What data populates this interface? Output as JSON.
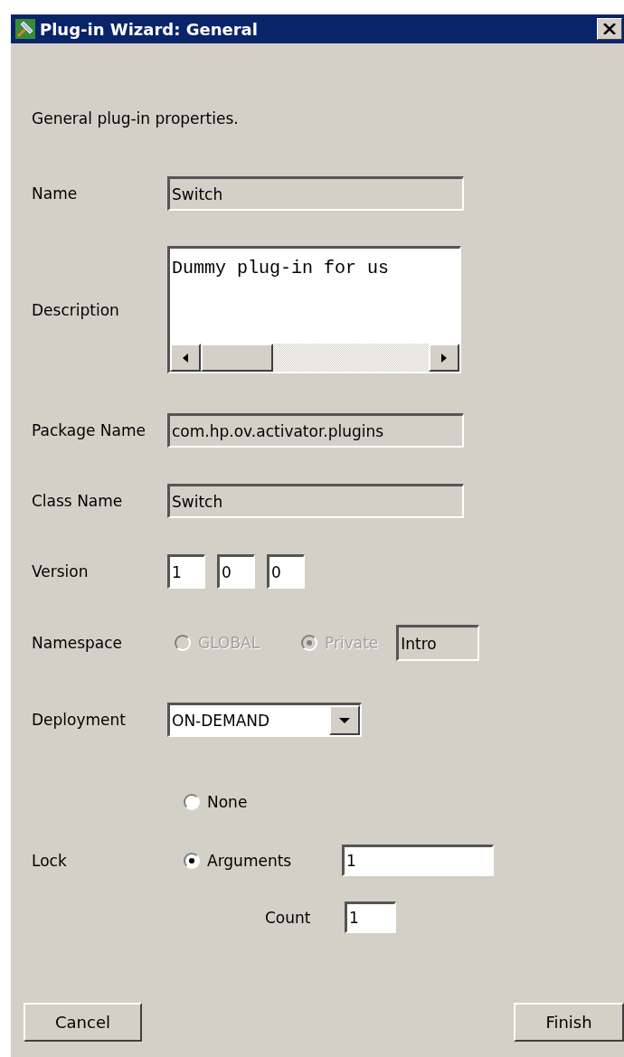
{
  "window": {
    "title": "Plug-in Wizard: General"
  },
  "intro": "General plug-in properties.",
  "name": {
    "label": "Name",
    "value": "Switch",
    "read_only": true
  },
  "description": {
    "label": "Description",
    "value": "Dummy plug-in for us",
    "read_only": false
  },
  "package_name": {
    "label": "Package Name",
    "value": "com.hp.ov.activator.plugins",
    "read_only": true
  },
  "class_name": {
    "label": "Class Name",
    "value": "Switch",
    "read_only": true
  },
  "version": {
    "label": "Version",
    "parts": [
      "1",
      "0",
      "0"
    ]
  },
  "namespace": {
    "label": "Namespace",
    "disabled": true,
    "options": [
      {
        "label": "GLOBAL",
        "selected": false
      },
      {
        "label": "Private",
        "selected": true
      }
    ],
    "value": "Intro"
  },
  "deployment": {
    "label": "Deployment",
    "value": "ON-DEMAND"
  },
  "lock": {
    "label": "Lock",
    "options": [
      {
        "label": "None",
        "selected": false
      },
      {
        "label": "Arguments",
        "selected": true
      }
    ],
    "arguments": "1",
    "count_label": "Count",
    "count": "1"
  },
  "buttons": [
    {
      "label": "Cancel"
    },
    {
      "label": "Finish"
    }
  ]
}
